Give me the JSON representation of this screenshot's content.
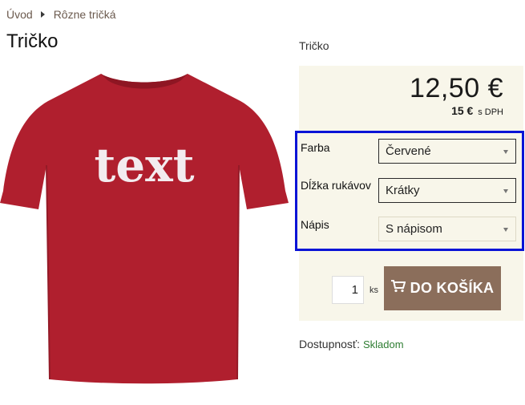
{
  "breadcrumb": {
    "home": "Úvod",
    "category": "Rôzne tričká"
  },
  "product": {
    "title": "Tričko",
    "side_name": "Tričko",
    "print_text": "text"
  },
  "price": {
    "main": "12,50 €",
    "vat_value": "15 €",
    "vat_suffix": "s DPH"
  },
  "options": [
    {
      "label": "Farba",
      "value": "Červené"
    },
    {
      "label": "Dĺžka rukávov",
      "value": "Krátky"
    },
    {
      "label": "Nápis",
      "value": "S nápisom"
    }
  ],
  "cart": {
    "quantity": "1",
    "unit": "ks",
    "button_label": "DO KOŠÍKA"
  },
  "availability": {
    "label": "Dostupnosť:",
    "status": "Skladom"
  },
  "colors": {
    "accent": "#8b6e5b",
    "shirt": "#b01f2e",
    "highlight": "#0a14d6",
    "stock": "#2e7d32",
    "panel": "#f8f6ea"
  }
}
